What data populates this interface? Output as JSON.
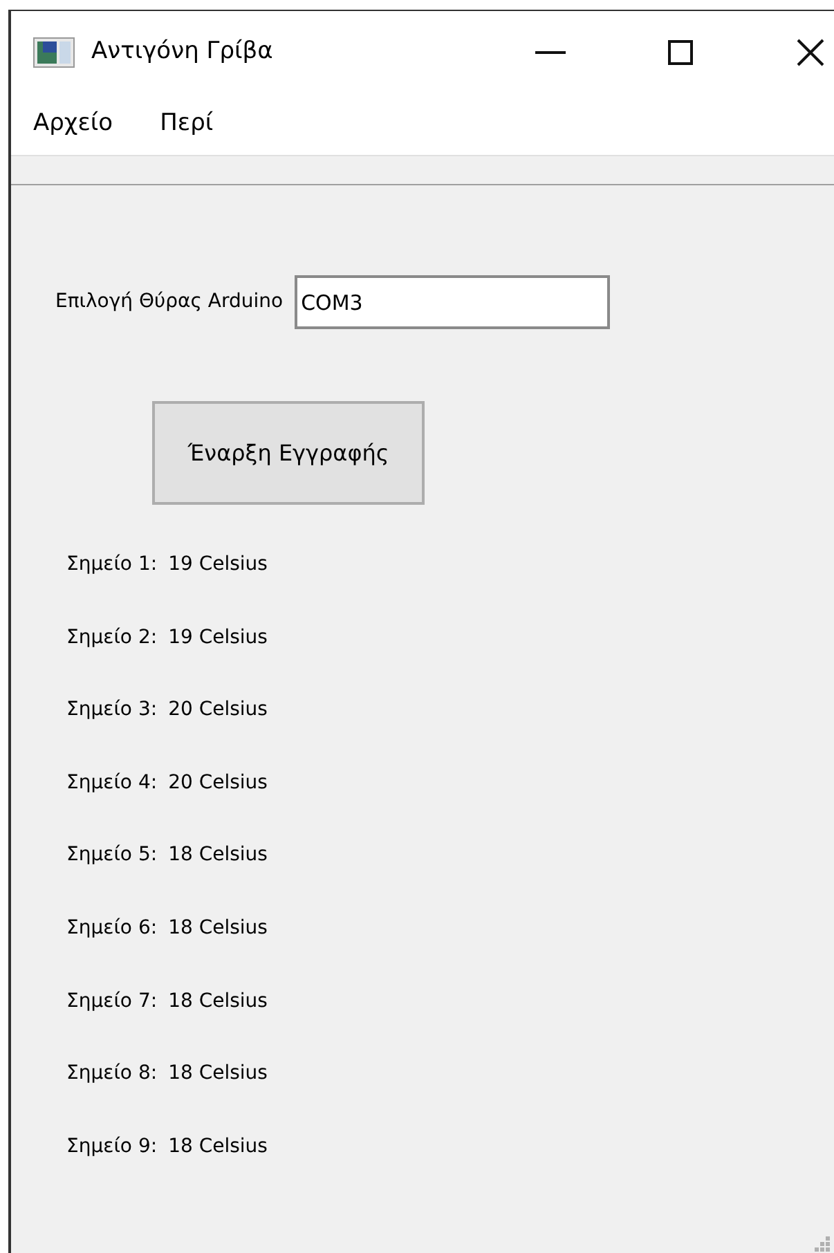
{
  "window": {
    "title": "Αντιγόνη Γρίβα"
  },
  "menu": [
    "Αρχείο",
    "Περί"
  ],
  "port": {
    "label": "Επιλογή Θύρας Arduino",
    "value": "COM3"
  },
  "button": "Έναρξη Εγγραφής",
  "points": [
    {
      "label": "Σημείο 1:",
      "value": "19 Celsius"
    },
    {
      "label": "Σημείο 2:",
      "value": "19 Celsius"
    },
    {
      "label": "Σημείο 3:",
      "value": "20 Celsius"
    },
    {
      "label": "Σημείο 4:",
      "value": "20 Celsius"
    },
    {
      "label": "Σημείο 5:",
      "value": "18 Celsius"
    },
    {
      "label": "Σημείο 6:",
      "value": "18 Celsius"
    },
    {
      "label": "Σημείο 7:",
      "value": "18 Celsius"
    },
    {
      "label": "Σημείο 8:",
      "value": "18 Celsius"
    },
    {
      "label": "Σημείο 9:",
      "value": "18 Celsius"
    }
  ]
}
